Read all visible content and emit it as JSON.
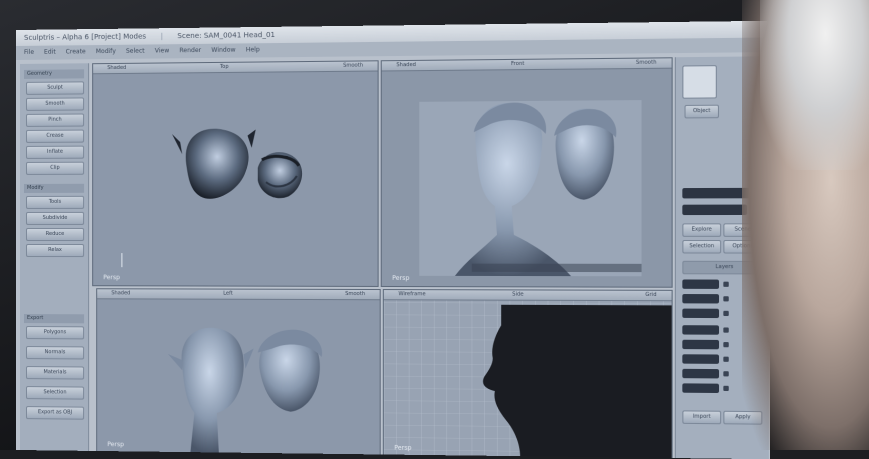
{
  "window": {
    "title": "Sculptris – Alpha 6 [Project] Modes",
    "scene": "Scene: SAM_0041 Head_01",
    "extra": "Project Modes"
  },
  "menu": [
    "File",
    "Edit",
    "Create",
    "Modify",
    "Select",
    "View",
    "Render",
    "Window",
    "Help"
  ],
  "left_panel": {
    "heading1": "Geometry",
    "buttons1": [
      "Sculpt",
      "Smooth",
      "Pinch",
      "Crease",
      "Inflate",
      "Clip"
    ],
    "heading2": "Modify",
    "buttons2": [
      "Tools",
      "Subdivide",
      "Reduce",
      "Relax"
    ],
    "heading3": "Export",
    "buttons3": [
      "Polygons",
      "Normals",
      "Materials",
      "Selection",
      "Export as OBJ"
    ]
  },
  "viewports": [
    {
      "name": "Top",
      "mode": "Shaded",
      "shading": "Smooth",
      "label": "Persp"
    },
    {
      "name": "Front",
      "mode": "Shaded",
      "shading": "Smooth",
      "label": "Persp"
    },
    {
      "name": "Left",
      "mode": "Shaded",
      "shading": "Smooth",
      "label": "Persp"
    },
    {
      "name": "Side",
      "mode": "Wireframe",
      "shading": "Grid",
      "label": "Persp"
    }
  ],
  "right_panel": {
    "object_label": "Object",
    "buttons": [
      "Explore",
      "Scene",
      "Selection",
      "Options"
    ],
    "layers_label": "Layers",
    "bottom_buttons": [
      "Import",
      "Apply"
    ]
  },
  "colors": {
    "viewport": "#8c98aa",
    "mesh": "#a9bad1",
    "panel": "#a3aebd"
  }
}
